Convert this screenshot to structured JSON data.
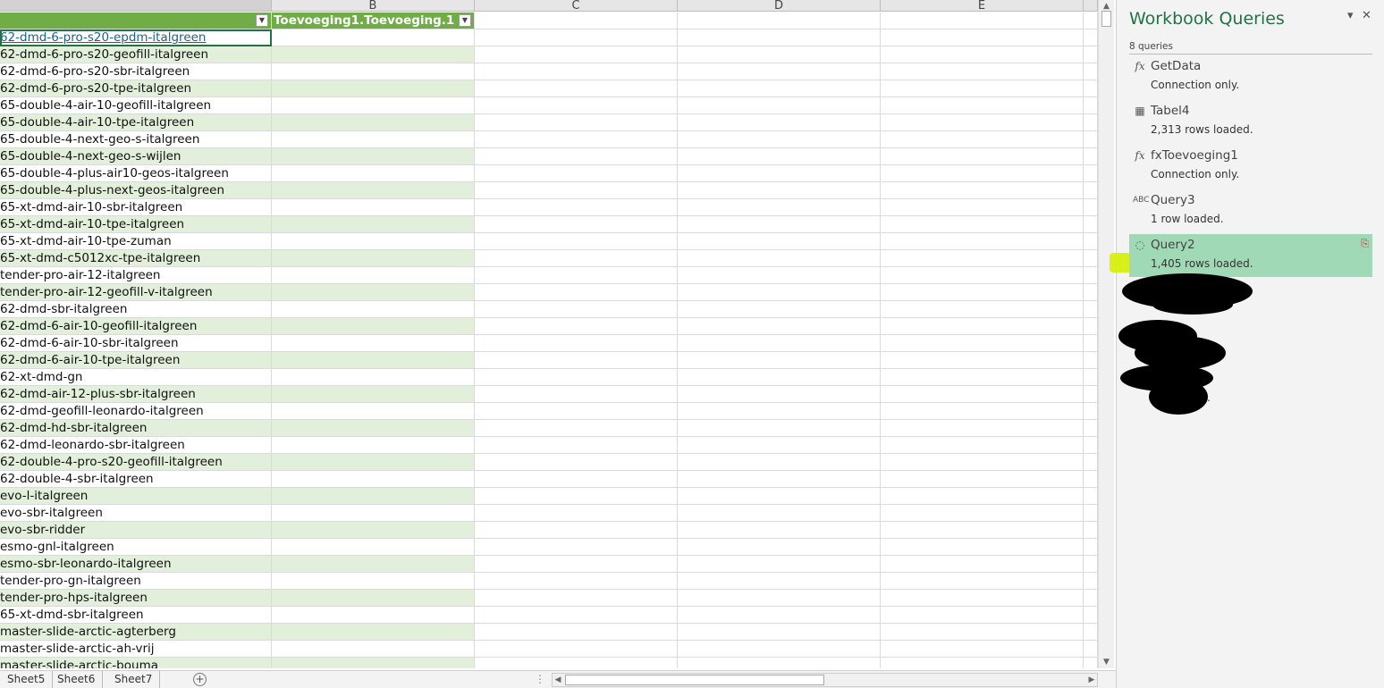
{
  "columns": {
    "b": "B",
    "c": "C",
    "d": "D",
    "e": "E"
  },
  "table_header": {
    "a": "",
    "b": "Toevoeging1.Toevoeging.1"
  },
  "rows": [
    "62-dmd-6-pro-s20-epdm-italgreen",
    "62-dmd-6-pro-s20-geofill-italgreen",
    "62-dmd-6-pro-s20-sbr-italgreen",
    "62-dmd-6-pro-s20-tpe-italgreen",
    "65-double-4-air-10-geofill-italgreen",
    "65-double-4-air-10-tpe-italgreen",
    "65-double-4-next-geo-s-italgreen",
    "65-double-4-next-geo-s-wijlen",
    "65-double-4-plus-air10-geos-italgreen",
    "65-double-4-plus-next-geos-italgreen",
    "65-xt-dmd-air-10-sbr-italgreen",
    "65-xt-dmd-air-10-tpe-italgreen",
    "65-xt-dmd-air-10-tpe-zuman",
    "65-xt-dmd-c5012xc-tpe-italgreen",
    "tender-pro-air-12-italgreen",
    "tender-pro-air-12-geofill-v-italgreen",
    "62-dmd-sbr-italgreen",
    "62-dmd-6-air-10-geofill-italgreen",
    "62-dmd-6-air-10-sbr-italgreen",
    "62-dmd-6-air-10-tpe-italgreen",
    "62-xt-dmd-gn",
    "62-dmd-air-12-plus-sbr-italgreen",
    "62-dmd-geofill-leonardo-italgreen",
    "62-dmd-hd-sbr-italgreen",
    "62-dmd-leonardo-sbr-italgreen",
    "62-double-4-pro-s20-geofill-italgreen",
    "62-double-4-sbr-italgreen",
    "evo-l-italgreen",
    "evo-sbr-italgreen",
    "evo-sbr-ridder",
    "esmo-gnl-italgreen",
    "esmo-sbr-leonardo-italgreen",
    "tender-pro-gn-italgreen",
    "tender-pro-hps-italgreen",
    "65-xt-dmd-sbr-italgreen",
    "master-slide-arctic-agterberg",
    "master-slide-arctic-ah-vrij",
    "master-slide-arctic-bouma"
  ],
  "sheet_tabs": [
    "Sheet5",
    "Sheet6",
    "Sheet7"
  ],
  "pane": {
    "title": "Workbook Queries",
    "count": "8 queries",
    "queries": [
      {
        "icon": "fx",
        "name": "GetData",
        "status": "Connection only."
      },
      {
        "icon": "table",
        "name": "Tabel4",
        "status": "2,313 rows loaded."
      },
      {
        "icon": "fx",
        "name": "fxToevoeging1",
        "status": "Connection only."
      },
      {
        "icon": "abc",
        "name": "Query3",
        "status": "1 row loaded."
      },
      {
        "icon": "loading",
        "name": "Query2",
        "status": "1,405 rows loaded."
      }
    ],
    "partial_text": "ed."
  }
}
